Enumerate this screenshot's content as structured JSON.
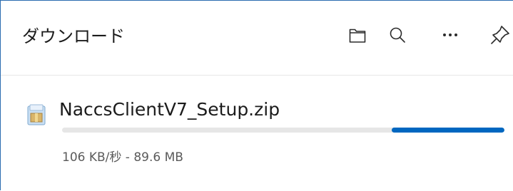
{
  "header": {
    "title": "ダウンロード",
    "icons": [
      "folder-icon",
      "search-icon",
      "more-icon",
      "pin-icon"
    ]
  },
  "download": {
    "filename": "NaccsClientV7_Setup.zip",
    "status": "106 KB/秒 - 89.6 MB",
    "file_icon": "zip-archive-icon",
    "progress_state": "indeterminate"
  },
  "colors": {
    "accent": "#0067c0",
    "track": "#e6e6e6",
    "border": "#2b6cb0"
  }
}
